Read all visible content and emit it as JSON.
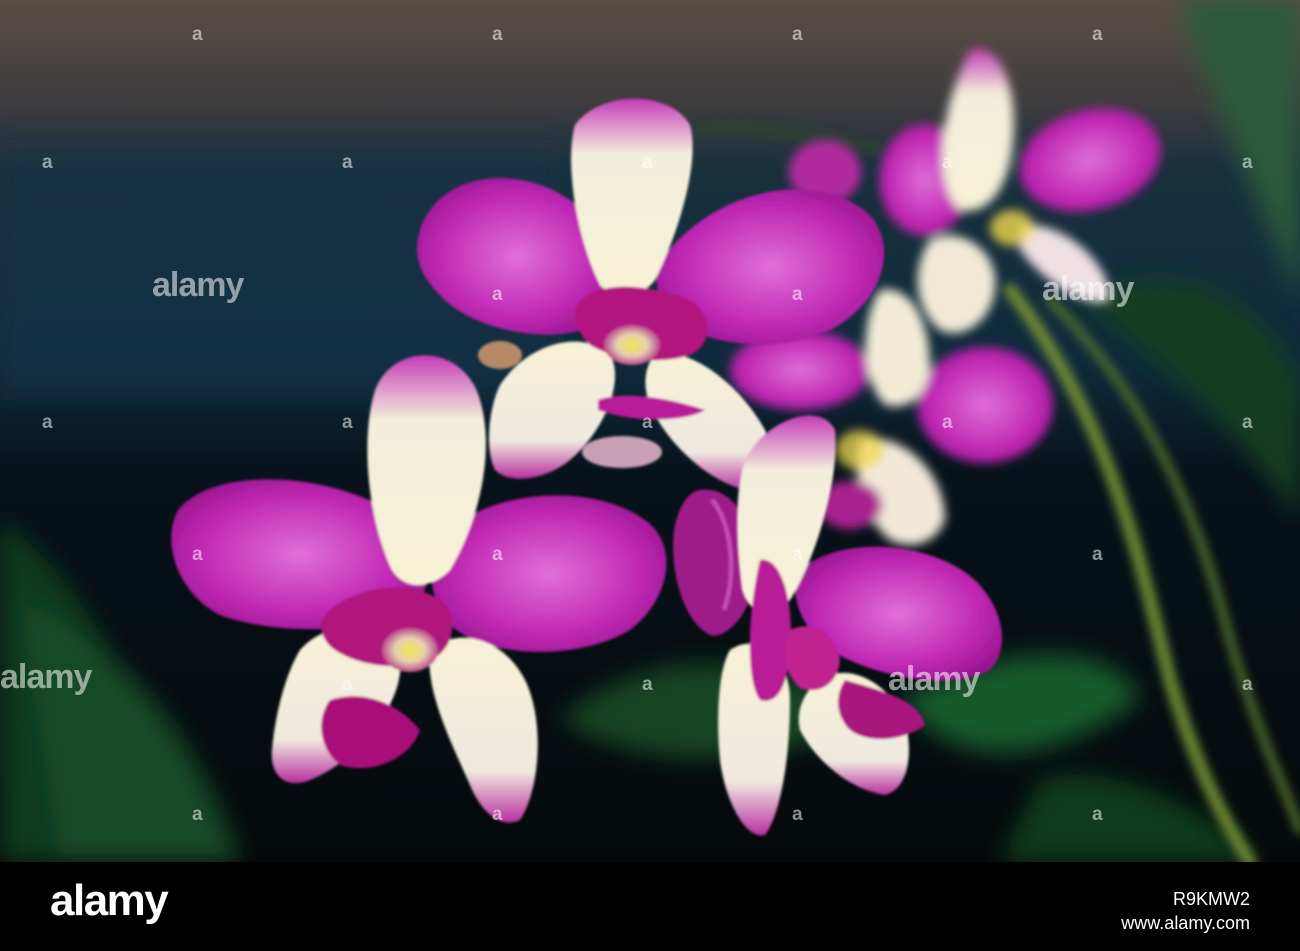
{
  "watermark": {
    "word": "alamy",
    "id_glyph": "a"
  },
  "footer": {
    "logo": "alamy",
    "image_id": "R9KMW2",
    "site": "www.alamy.com"
  }
}
